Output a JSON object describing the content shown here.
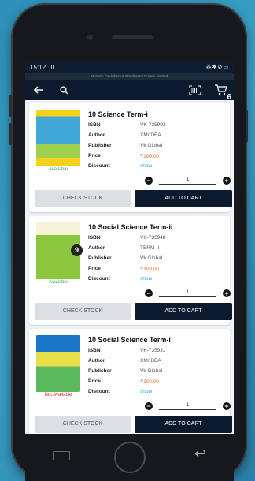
{
  "status": {
    "time": "15:12",
    "signal": ".ıll",
    "right_icons": "⁂✱⊘▭"
  },
  "banner": "Unicorn Publishers & Distributors Private Limited",
  "appbar": {
    "cart_count": "6"
  },
  "labels": {
    "isbn": "ISBN",
    "author": "Author",
    "publisher": "Publisher",
    "price": "Price",
    "discount": "Discount",
    "check_stock": "CHECK STOCK",
    "add_to_cart": "ADD TO CART"
  },
  "products": [
    {
      "title": "10 Science Term-i",
      "isbn": "VK-735993",
      "author": "XM/IDEA",
      "publisher": "Vk Global",
      "price": "₹100.00",
      "discount": "show",
      "availability": "Available",
      "qty": "1"
    },
    {
      "title": "10 Social Science Term-ii",
      "isbn": "VK-735948",
      "author": "TERM-II",
      "publisher": "Vk Global",
      "price": "₹100.00",
      "discount": "show",
      "availability": "Available",
      "qty": "1",
      "badge": "9"
    },
    {
      "title": "10 Social Science Term-i",
      "isbn": "VK-735931",
      "author": "XM/IDEA",
      "publisher": "Vk Global",
      "price": "₹100.00",
      "discount": "show",
      "availability": "Not Available",
      "qty": "1"
    }
  ],
  "colors": {
    "appbar": "#0b1a2c",
    "price": "#f26522",
    "available": "#2db34a",
    "not_available": "#e02b2b",
    "link": "#1aa0dc"
  }
}
